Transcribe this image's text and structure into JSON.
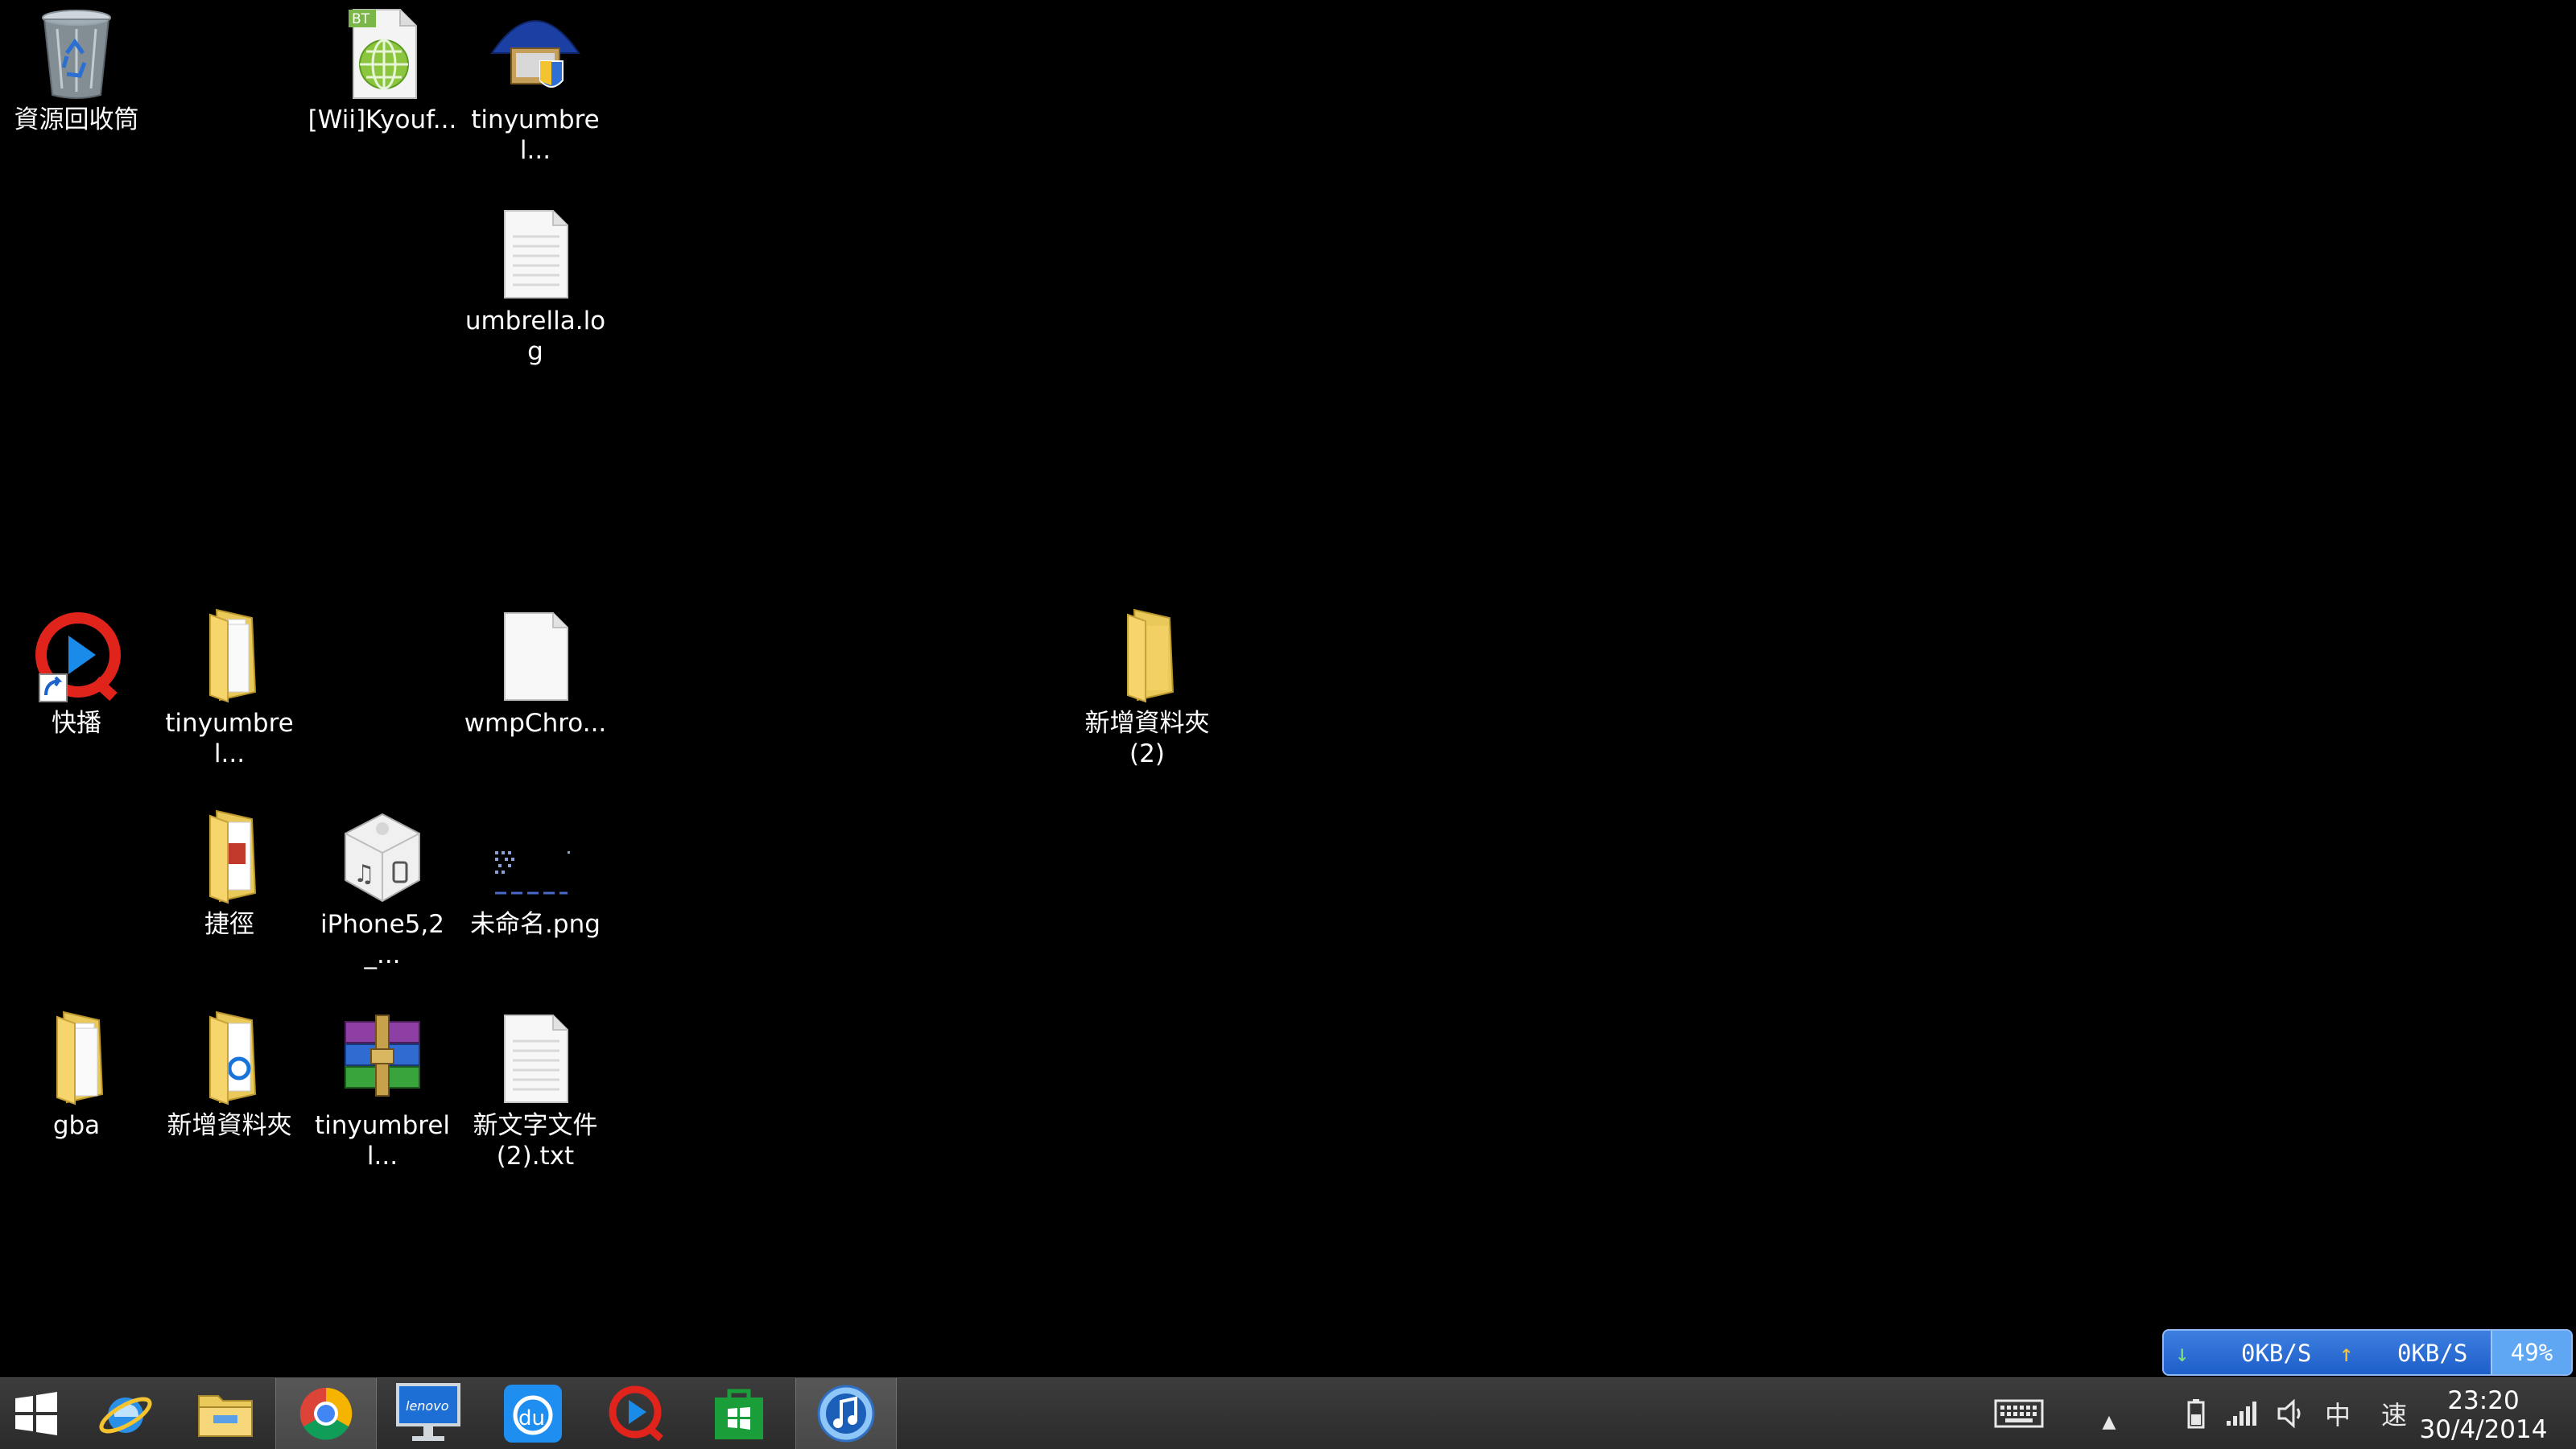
{
  "desktop": {
    "icons": [
      {
        "label": "資源回收筒",
        "icon": "recycle-bin-icon"
      },
      {
        "label": "[Wii]Kyouf...",
        "icon": "bt-torrent-file-icon"
      },
      {
        "label": "tinyumbrel...",
        "icon": "tinyumbrella-app-icon"
      },
      {
        "label": "umbrella.log",
        "icon": "text-file-icon"
      },
      {
        "label": "快播",
        "icon": "qvod-player-shortcut-icon"
      },
      {
        "label": "tinyumbrel...",
        "icon": "folder-icon"
      },
      {
        "label": "wmpChro...",
        "icon": "blank-file-icon"
      },
      {
        "label": "新增資料夾 (2)",
        "icon": "folder-icon"
      },
      {
        "label": "捷徑",
        "icon": "folder-icon"
      },
      {
        "label": "iPhone5,2_...",
        "icon": "ipsw-file-icon"
      },
      {
        "label": "未命名.png",
        "icon": "png-image-icon"
      },
      {
        "label": "gba",
        "icon": "folder-icon"
      },
      {
        "label": "新增資料夾",
        "icon": "folder-icon"
      },
      {
        "label": "tinyumbrell...",
        "icon": "winrar-archive-icon"
      },
      {
        "label": "新文字文件 (2).txt",
        "icon": "text-file-icon"
      }
    ]
  },
  "speed_widget": {
    "download": "0KB/S",
    "upload": "0KB/S",
    "percent": "49%",
    "percent_value": 0.49
  },
  "taskbar": {
    "buttons": [
      {
        "icon": "windows-start-icon"
      },
      {
        "icon": "internet-explorer-icon"
      },
      {
        "icon": "file-explorer-icon"
      },
      {
        "icon": "chrome-icon"
      },
      {
        "icon": "lenovo-monitor-icon"
      },
      {
        "icon": "baidu-du-icon"
      },
      {
        "icon": "qvod-player-icon"
      },
      {
        "icon": "windows-store-icon"
      },
      {
        "icon": "itunes-icon"
      }
    ],
    "tray": {
      "ime": "中",
      "speed_char": "速"
    },
    "clock": {
      "time": "23:20",
      "date": "30/4/2014"
    }
  }
}
